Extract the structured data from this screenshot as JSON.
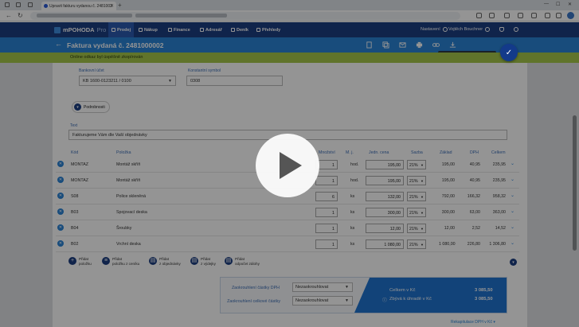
{
  "browser": {
    "tab_title": "Upravit fakturu vydanou č. 2481002",
    "close_glyph": "✕",
    "new_tab_glyph": "+",
    "back_glyph": "←",
    "reload_glyph": "↻"
  },
  "app": {
    "logo": "mPOHODA",
    "logo_suffix": "Pro",
    "nav": [
      {
        "label": "Prodej",
        "icon": "sale-icon"
      },
      {
        "label": "Nákup",
        "icon": "purchase-icon"
      },
      {
        "label": "Finance",
        "icon": "finance-icon"
      },
      {
        "label": "Adresář",
        "icon": "contacts-icon"
      },
      {
        "label": "Deník",
        "icon": "journal-icon"
      },
      {
        "label": "Přehledy",
        "icon": "reports-icon"
      }
    ],
    "settings_label": "Nastavení",
    "user_name": "Vojtěch Bouchner"
  },
  "page": {
    "title": "Faktura vydaná č. 2481000002",
    "tooltip": "Zkopírovat online odkaz dokladu",
    "banner": "Online odkaz byl úspěšně zkopírován",
    "save_glyph": "✓"
  },
  "form": {
    "bank_label": "Bankovní účet",
    "bank_value": "KB  1600-0123211 / 0100",
    "const_label": "Konstantní symbol",
    "const_value": "0308",
    "more_label": "Podrobnosti",
    "text_label": "Text",
    "text_value": "Fakturujeme Vám dle Vaší objednávky"
  },
  "table": {
    "headers": [
      "Kód",
      "Položka",
      "Množství",
      "M. j.",
      "Jedn. cena",
      "Sazba",
      "Základ",
      "DPH",
      "Celkem"
    ],
    "rows": [
      {
        "code": "MONTAZ",
        "item": "Montáž skříň",
        "qty": "1",
        "unit": "hod.",
        "price": "195,00",
        "rate": "21%",
        "base": "195,00",
        "vat": "40,95",
        "total": "235,95"
      },
      {
        "code": "MONTAZ",
        "item": "Montáž skříň",
        "qty": "1",
        "unit": "hod.",
        "price": "195,00",
        "rate": "21%",
        "base": "195,00",
        "vat": "40,95",
        "total": "235,95"
      },
      {
        "code": "S08",
        "item": "Police skleněná",
        "qty": "6",
        "unit": "ks",
        "price": "132,00",
        "rate": "21%",
        "base": "792,00",
        "vat": "166,32",
        "total": "958,32"
      },
      {
        "code": "B03",
        "item": "Spojovací deska",
        "qty": "1",
        "unit": "ks",
        "price": "300,00",
        "rate": "21%",
        "base": "300,00",
        "vat": "63,00",
        "total": "363,00"
      },
      {
        "code": "B04",
        "item": "Šroubky",
        "qty": "1",
        "unit": "ks",
        "price": "12,00",
        "rate": "21%",
        "base": "12,00",
        "vat": "2,52",
        "total": "14,52"
      },
      {
        "code": "B02",
        "item": "Vrchní deska",
        "qty": "1",
        "unit": "ks",
        "price": "1 080,00",
        "rate": "21%",
        "base": "1 080,00",
        "vat": "226,80",
        "total": "1 306,80"
      }
    ]
  },
  "add_buttons": [
    {
      "line1": "Přidat",
      "line2": "položku"
    },
    {
      "line1": "Přidat",
      "line2": "položku z ceníku"
    },
    {
      "line1": "Přidat",
      "line2": "z objednávky"
    },
    {
      "line1": "Přidat",
      "line2": "z výdejky"
    },
    {
      "line1": "Přidat",
      "line2": "odpočet zálohy"
    }
  ],
  "summary": {
    "rounding_vat_label": "Zaokrouhlení částky DPH",
    "rounding_vat_value": "Nezaokrouhlovat",
    "rounding_total_label": "Zaokrouhlení celkové částky",
    "rounding_total_value": "Nezaokrouhlovat",
    "total_label": "Celkem v Kč",
    "total_value": "3 085,50",
    "due_label": "Zbývá k úhradě v Kč",
    "due_value": "3 085,50",
    "vat_recap_link": "Rekapitulace DPH v Kč"
  },
  "colors": {
    "nav_bg": "#1d3f82",
    "title_bg": "#2a83d6",
    "banner_bg": "#a6c94b"
  }
}
